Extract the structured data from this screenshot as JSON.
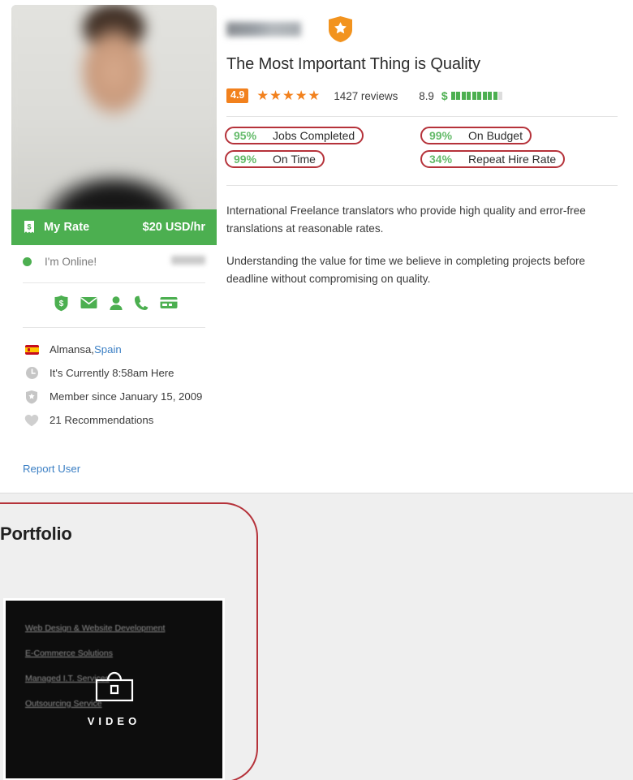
{
  "profile": {
    "name_redacted": true,
    "verified_badge_icon": "verified-shield-star-icon",
    "headline": "The Most Important Thing is Quality",
    "rating": {
      "score": "4.9",
      "stars": "★★★★★",
      "reviews": "1427 reviews",
      "money_score": "8.9",
      "money_sign": "$",
      "money_meter_filled": 9,
      "money_meter_total": 10
    },
    "stats": [
      {
        "pct": "95%",
        "label": "Jobs Completed"
      },
      {
        "pct": "99%",
        "label": "On Time"
      },
      {
        "pct": "99%",
        "label": "On Budget"
      },
      {
        "pct": "34%",
        "label": "Repeat Hire Rate"
      }
    ],
    "bio": [
      "International Freelance translators who provide high quality and error-free translations at reasonable rates.",
      "Understanding the value for time we believe in completing projects before deadline without compromising on quality."
    ]
  },
  "sidebar": {
    "avatar_alt": "profile-photo",
    "rate": {
      "icon": "receipt-dollar-icon",
      "label": "My Rate",
      "value": "$20 USD/hr"
    },
    "status": {
      "dot_color": "#4caf50",
      "text": "I'm Online!"
    },
    "contact_icons": [
      "shield-dollar-icon",
      "envelope-icon",
      "person-icon",
      "phone-icon",
      "credit-card-icon"
    ],
    "info": [
      {
        "icon": "spain-flag-icon",
        "text": "Almansa, ",
        "link": "Spain"
      },
      {
        "icon": "clock-icon",
        "text": "It's Currently 8:58am Here"
      },
      {
        "icon": "member-badge-icon",
        "text": "Member since January 15, 2009"
      },
      {
        "icon": "heart-icon",
        "text": "21 Recommendations"
      }
    ],
    "report_user": "Report User"
  },
  "portfolio": {
    "title": "Portfolio",
    "video": {
      "services": [
        "Web Design & Website Development",
        "E-Commerce Solutions",
        "Managed I.T. Services",
        "Outsourcing Service"
      ],
      "icon": "briefcase-icon",
      "caption": "VIDEO"
    }
  },
  "colors": {
    "brand_green": "#4caf50",
    "accent_orange": "#f2811d",
    "annotation_red": "#b5323a",
    "link_blue": "#3b7fc4",
    "page_bg": "#efefef"
  }
}
